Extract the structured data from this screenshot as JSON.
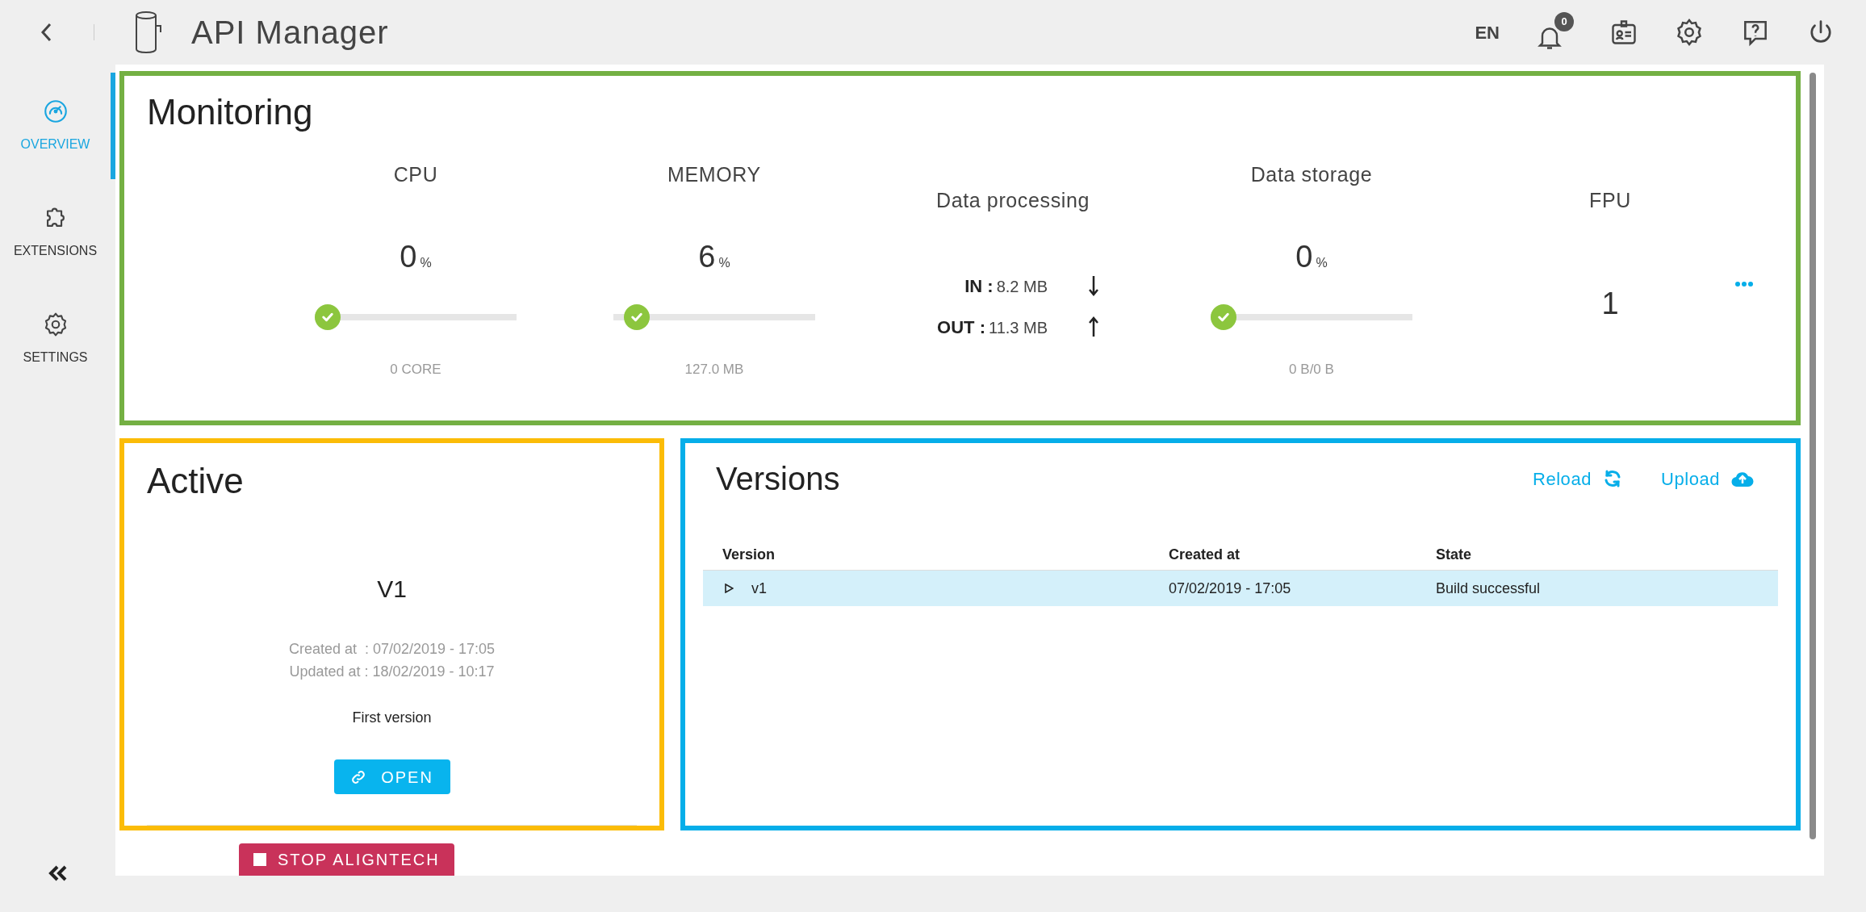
{
  "header": {
    "title": "API Manager",
    "language": "EN",
    "notifications": "0"
  },
  "sidebar": {
    "items": [
      {
        "label": "OVERVIEW",
        "kind": "gauge",
        "selected": true
      },
      {
        "label": "EXTENSIONS",
        "kind": "puzzle",
        "selected": false
      },
      {
        "label": "SETTINGS",
        "kind": "gear",
        "selected": false
      }
    ]
  },
  "monitoring": {
    "title": "Monitoring",
    "metrics": [
      {
        "kind": "gauge",
        "title": "CPU",
        "value": "0",
        "unit": "%",
        "level": 0,
        "caption": "0 CORE"
      },
      {
        "kind": "gauge",
        "title": "MEMORY",
        "value": "6",
        "unit": "%",
        "level": 0.06,
        "caption": "127.0 MB"
      },
      {
        "kind": "io",
        "title": "Data processing",
        "rows": [
          {
            "kind": "down",
            "label": "IN :",
            "value": "8.2 MB"
          },
          {
            "kind": "up",
            "label": "OUT :",
            "value": "11.3 MB"
          }
        ]
      },
      {
        "kind": "gauge",
        "title": "Data storage",
        "value": "0",
        "unit": "%",
        "level": 0,
        "caption": "0 B/0 B"
      },
      {
        "kind": "count",
        "title": "FPU",
        "value": "1"
      }
    ]
  },
  "active": {
    "title": "Active",
    "version": "V1",
    "created": "Created at  : 07/02/2019 - 17:05",
    "updated": "Updated at : 18/02/2019 - 10:17",
    "description": "First version",
    "button": "OPEN"
  },
  "stop_button": "STOP ALIGNTECH",
  "versions": {
    "title": "Versions",
    "actions": [
      {
        "label": "Reload",
        "kind": "reload"
      },
      {
        "label": "Upload",
        "kind": "upload"
      }
    ],
    "columns": [
      "Version",
      "Created at",
      "State"
    ],
    "rows": [
      {
        "cells": [
          "v1",
          "07/02/2019 - 17:05",
          "Build successful"
        ],
        "selected": true
      }
    ]
  }
}
